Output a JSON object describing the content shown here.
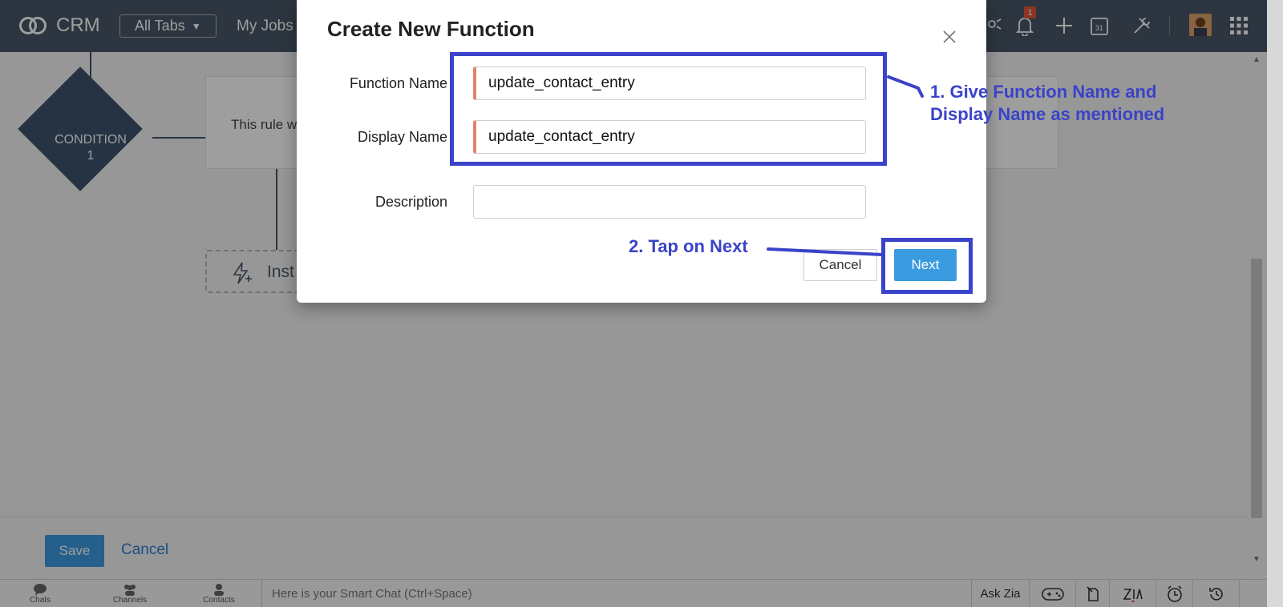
{
  "app": {
    "name": "CRM"
  },
  "nav": {
    "all_tabs": "All Tabs",
    "my_jobs": "My Jobs",
    "notifications_count": "1",
    "calendar_day": "31"
  },
  "canvas": {
    "condition_label_line1": "CONDITION",
    "condition_label_line2": "1",
    "rule_text": "This rule w",
    "instant_action_text": "Inst"
  },
  "footer": {
    "save_label": "Save",
    "cancel_label": "Cancel"
  },
  "bottom_bar": {
    "chats": "Chats",
    "channels": "Channels",
    "contacts": "Contacts",
    "smart_chat_placeholder": "Here is your Smart Chat (Ctrl+Space)",
    "ask_zia": "Ask Zia"
  },
  "modal": {
    "title": "Create New Function",
    "fields": [
      {
        "label": "Function Name",
        "value": "update_contact_entry",
        "required": true
      },
      {
        "label": "Display Name",
        "value": "update_contact_entry",
        "required": true
      },
      {
        "label": "Description",
        "value": "",
        "required": false
      }
    ],
    "cancel_label": "Cancel",
    "next_label": "Next"
  },
  "annotations": {
    "step1_line1": "1. Give Function Name and",
    "step1_line2": "Display Name as mentioned",
    "step2": "2. Tap on Next",
    "color": "#3a43c9"
  },
  "colors": {
    "topbar": "#4a5868",
    "primary_button": "#3b9be0",
    "condition_node": "#3e536c",
    "required_marker": "#e5826f"
  }
}
